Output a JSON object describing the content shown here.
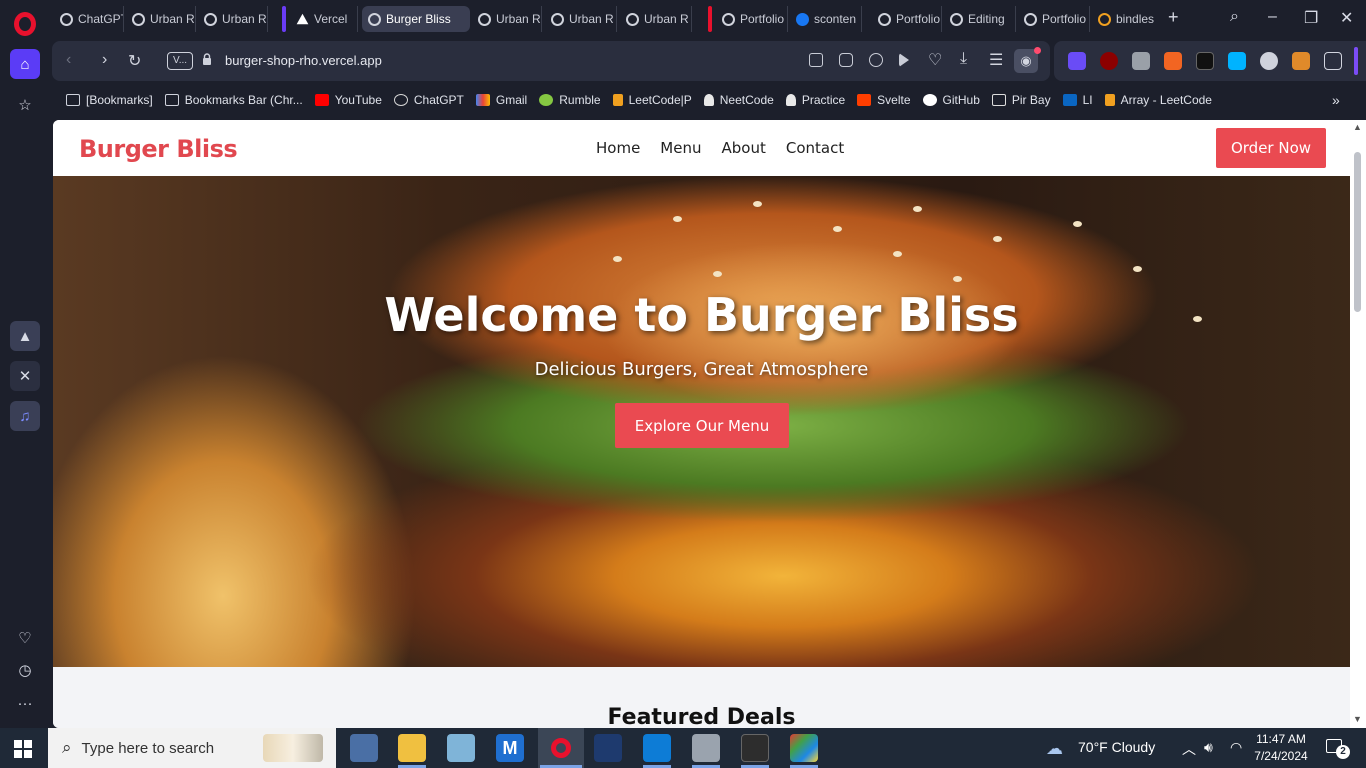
{
  "browser": {
    "tabs": [
      {
        "label": "ChatGPT",
        "active": false
      },
      {
        "label": "Urban R",
        "active": false
      },
      {
        "label": "Urban R",
        "active": false
      },
      {
        "label": "Vercel",
        "active": false
      },
      {
        "label": "Burger Bliss",
        "active": true
      },
      {
        "label": "Urban R",
        "active": false
      },
      {
        "label": "Urban R",
        "active": false
      },
      {
        "label": "Urban R",
        "active": false
      },
      {
        "label": "Portfolio",
        "active": false
      },
      {
        "label": "sconten",
        "active": false
      },
      {
        "label": "Portfolio",
        "active": false
      },
      {
        "label": "Editing",
        "active": false
      },
      {
        "label": "Portfolio",
        "active": false
      },
      {
        "label": "bindles",
        "active": false
      }
    ],
    "url_badge": "V...",
    "url": "burger-shop-rho.vercel.app",
    "bookmarks": [
      {
        "label": "[Bookmarks]",
        "color": "#cfd2dc"
      },
      {
        "label": "Bookmarks Bar (Chr...",
        "color": "#cfd2dc"
      },
      {
        "label": "YouTube",
        "color": "#ff0000"
      },
      {
        "label": "ChatGPT",
        "color": "#d6d6d6"
      },
      {
        "label": "Gmail",
        "color": "#ea4335"
      },
      {
        "label": "Rumble",
        "color": "#85c742"
      },
      {
        "label": "LeetCode|P",
        "color": "#f0a020"
      },
      {
        "label": "NeetCode",
        "color": "#e8e8e8"
      },
      {
        "label": "Practice",
        "color": "#e8e8e8"
      },
      {
        "label": "Svelte",
        "color": "#ff3e00"
      },
      {
        "label": "GitHub",
        "color": "#ffffff"
      },
      {
        "label": "Pir Bay",
        "color": "#dddddd"
      },
      {
        "label": "LI",
        "color": "#0a66c2"
      },
      {
        "label": "Array - LeetCode",
        "color": "#f0a020"
      }
    ]
  },
  "site": {
    "brand": "Burger Bliss",
    "nav": [
      "Home",
      "Menu",
      "About",
      "Contact"
    ],
    "order_button": "Order Now",
    "hero_title": "Welcome to Burger Bliss",
    "hero_subtitle": "Delicious Burgers, Great Atmosphere",
    "hero_button": "Explore Our Menu",
    "featured_heading": "Featured Deals",
    "accent_color": "#ea4a51"
  },
  "taskbar": {
    "search_placeholder": "Type here to search",
    "weather": "70°F  Cloudy",
    "time": "11:47 AM",
    "date": "7/24/2024",
    "notifications": "2"
  }
}
